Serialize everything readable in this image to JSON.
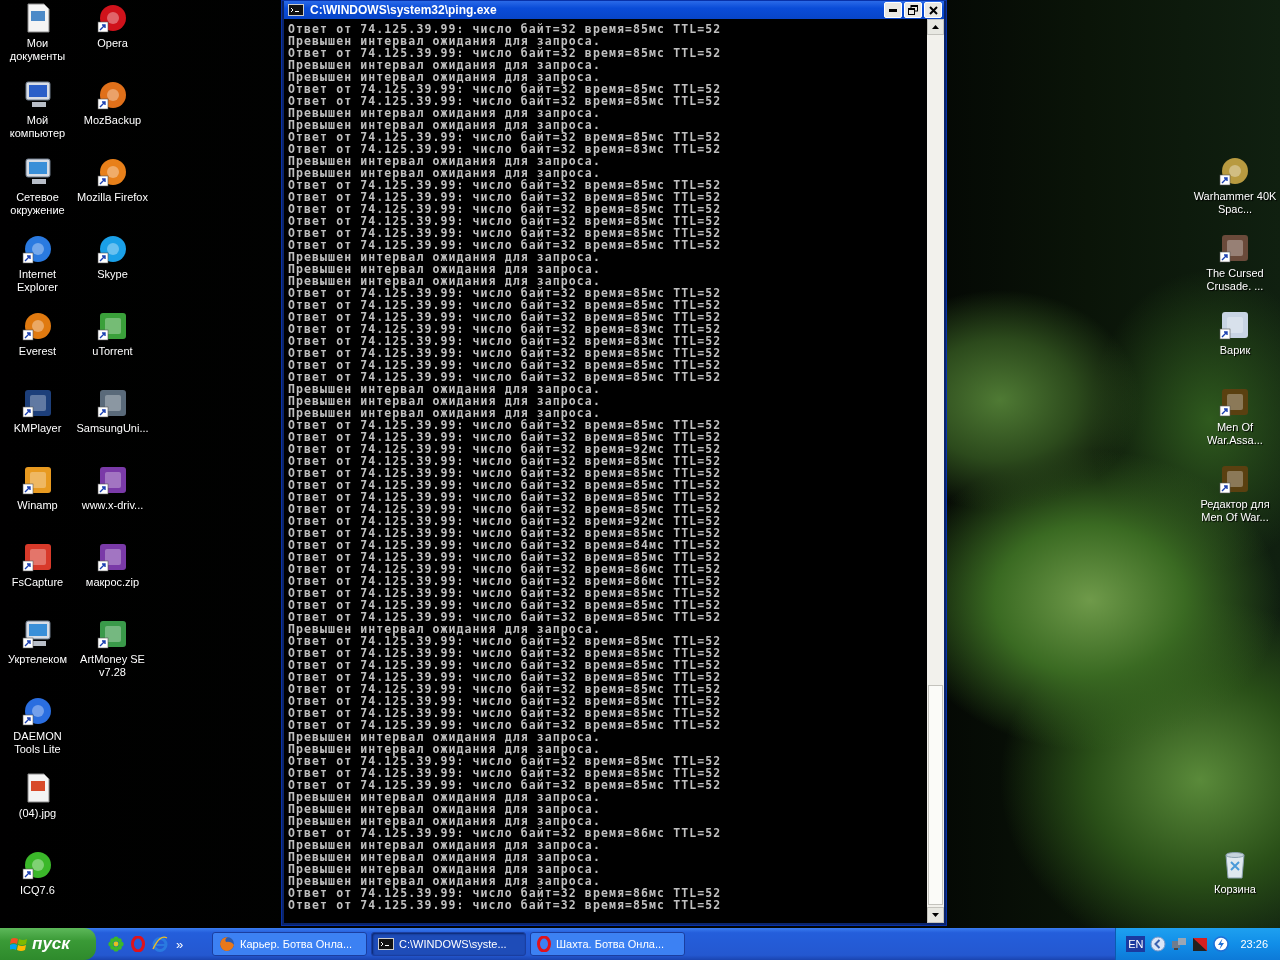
{
  "desktop": {
    "icons_column_1": [
      {
        "label": "Мои документы"
      },
      {
        "label": "Мой компьютер"
      },
      {
        "label": "Сетевое окружение"
      },
      {
        "label": "Internet Explorer"
      },
      {
        "label": "Everest"
      },
      {
        "label": "KMPlayer"
      },
      {
        "label": "Winamp"
      },
      {
        "label": "FsCapture"
      },
      {
        "label": "Укртелеком"
      },
      {
        "label": "DAEMON Tools Lite"
      },
      {
        "label": "(04).jpg"
      },
      {
        "label": "ICQ7.6"
      }
    ],
    "icons_column_2": [
      {
        "label": "Opera"
      },
      {
        "label": "MozBackup"
      },
      {
        "label": "Mozilla Firefox"
      },
      {
        "label": "Skype"
      },
      {
        "label": "uTorrent"
      },
      {
        "label": "SamsungUni..."
      },
      {
        "label": "www.x-driv..."
      },
      {
        "label": "макрос.zip"
      },
      {
        "label": "ArtMoney SE v7.28"
      }
    ],
    "icons_right": [
      {
        "label": "Warhammer 40K Spac..."
      },
      {
        "label": "The Cursed Crusade. ..."
      },
      {
        "label": "Варик"
      },
      {
        "label": "Men Of War.Assa..."
      },
      {
        "label": "Редактор для Men Of War..."
      }
    ],
    "recycle_bin": {
      "label": "Корзина"
    }
  },
  "console": {
    "title": "C:\\WINDOWS\\system32\\ping.exe",
    "lines": [
      "Ответ от 74.125.39.99: число байт=32 время=85мс TTL=52",
      "Превышен интервал ожидания для запроса.",
      "Ответ от 74.125.39.99: число байт=32 время=85мс TTL=52",
      "Превышен интервал ожидания для запроса.",
      "Превышен интервал ожидания для запроса.",
      "Ответ от 74.125.39.99: число байт=32 время=85мс TTL=52",
      "Ответ от 74.125.39.99: число байт=32 время=85мс TTL=52",
      "Превышен интервал ожидания для запроса.",
      "Превышен интервал ожидания для запроса.",
      "Ответ от 74.125.39.99: число байт=32 время=85мс TTL=52",
      "Ответ от 74.125.39.99: число байт=32 время=83мс TTL=52",
      "Превышен интервал ожидания для запроса.",
      "Превышен интервал ожидания для запроса.",
      "Ответ от 74.125.39.99: число байт=32 время=85мс TTL=52",
      "Ответ от 74.125.39.99: число байт=32 время=85мс TTL=52",
      "Ответ от 74.125.39.99: число байт=32 время=85мс TTL=52",
      "Ответ от 74.125.39.99: число байт=32 время=85мс TTL=52",
      "Ответ от 74.125.39.99: число байт=32 время=85мс TTL=52",
      "Ответ от 74.125.39.99: число байт=32 время=85мс TTL=52",
      "Превышен интервал ожидания для запроса.",
      "Превышен интервал ожидания для запроса.",
      "Превышен интервал ожидания для запроса.",
      "Ответ от 74.125.39.99: число байт=32 время=85мс TTL=52",
      "Ответ от 74.125.39.99: число байт=32 время=85мс TTL=52",
      "Ответ от 74.125.39.99: число байт=32 время=85мс TTL=52",
      "Ответ от 74.125.39.99: число байт=32 время=83мс TTL=52",
      "Ответ от 74.125.39.99: число байт=32 время=83мс TTL=52",
      "Ответ от 74.125.39.99: число байт=32 время=85мс TTL=52",
      "Ответ от 74.125.39.99: число байт=32 время=85мс TTL=52",
      "Ответ от 74.125.39.99: число байт=32 время=85мс TTL=52",
      "Превышен интервал ожидания для запроса.",
      "Превышен интервал ожидания для запроса.",
      "Превышен интервал ожидания для запроса.",
      "Ответ от 74.125.39.99: число байт=32 время=85мс TTL=52",
      "Ответ от 74.125.39.99: число байт=32 время=85мс TTL=52",
      "Ответ от 74.125.39.99: число байт=32 время=92мс TTL=52",
      "Ответ от 74.125.39.99: число байт=32 время=85мс TTL=52",
      "Ответ от 74.125.39.99: число байт=32 время=85мс TTL=52",
      "Ответ от 74.125.39.99: число байт=32 время=85мс TTL=52",
      "Ответ от 74.125.39.99: число байт=32 время=85мс TTL=52",
      "Ответ от 74.125.39.99: число байт=32 время=85мс TTL=52",
      "Ответ от 74.125.39.99: число байт=32 время=92мс TTL=52",
      "Ответ от 74.125.39.99: число байт=32 время=85мс TTL=52",
      "Ответ от 74.125.39.99: число байт=32 время=84мс TTL=52",
      "Ответ от 74.125.39.99: число байт=32 время=85мс TTL=52",
      "Ответ от 74.125.39.99: число байт=32 время=86мс TTL=52",
      "Ответ от 74.125.39.99: число байт=32 время=86мс TTL=52",
      "Ответ от 74.125.39.99: число байт=32 время=85мс TTL=52",
      "Ответ от 74.125.39.99: число байт=32 время=85мс TTL=52",
      "Ответ от 74.125.39.99: число байт=32 время=85мс TTL=52",
      "Превышен интервал ожидания для запроса.",
      "Ответ от 74.125.39.99: число байт=32 время=85мс TTL=52",
      "Ответ от 74.125.39.99: число байт=32 время=85мс TTL=52",
      "Ответ от 74.125.39.99: число байт=32 время=85мс TTL=52",
      "Ответ от 74.125.39.99: число байт=32 время=85мс TTL=52",
      "Ответ от 74.125.39.99: число байт=32 время=85мс TTL=52",
      "Ответ от 74.125.39.99: число байт=32 время=85мс TTL=52",
      "Ответ от 74.125.39.99: число байт=32 время=85мс TTL=52",
      "Ответ от 74.125.39.99: число байт=32 время=85мс TTL=52",
      "Превышен интервал ожидания для запроса.",
      "Превышен интервал ожидания для запроса.",
      "Ответ от 74.125.39.99: число байт=32 время=85мс TTL=52",
      "Ответ от 74.125.39.99: число байт=32 время=85мс TTL=52",
      "Ответ от 74.125.39.99: число байт=32 время=85мс TTL=52",
      "Превышен интервал ожидания для запроса.",
      "Превышен интервал ожидания для запроса.",
      "Превышен интервал ожидания для запроса.",
      "Ответ от 74.125.39.99: число байт=32 время=86мс TTL=52",
      "Превышен интервал ожидания для запроса.",
      "Превышен интервал ожидания для запроса.",
      "Превышен интервал ожидания для запроса.",
      "Превышен интервал ожидания для запроса.",
      "Ответ от 74.125.39.99: число байт=32 время=86мс TTL=52",
      "Ответ от 74.125.39.99: число байт=32 время=85мс TTL=52"
    ]
  },
  "taskbar": {
    "start_label": "пуск",
    "quick_launch_more": "»",
    "tasks": [
      {
        "label": "Карьер. Ботва Онла...",
        "selected": false
      },
      {
        "label": "C:\\WINDOWS\\syste...",
        "selected": true
      },
      {
        "label": "Шахта. Ботва Онла...",
        "selected": false
      }
    ],
    "language": "EN",
    "clock": "23:26"
  }
}
